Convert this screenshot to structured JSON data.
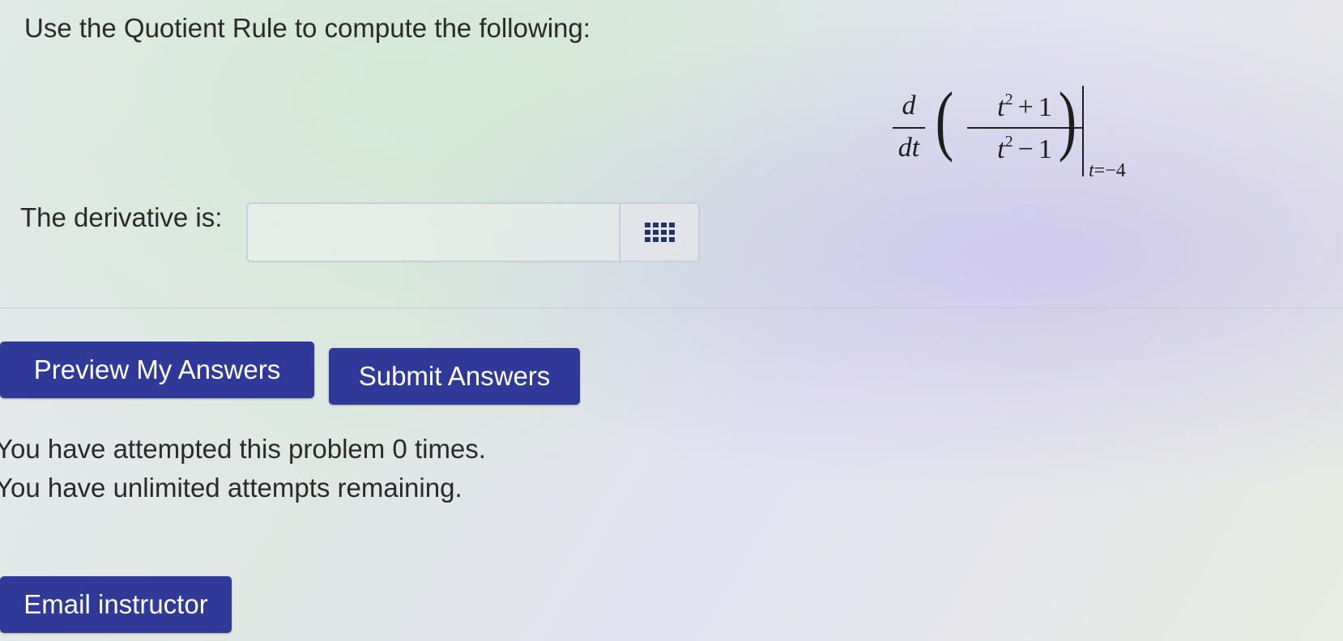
{
  "question": {
    "instruction": "Use the Quotient Rule to compute the following:"
  },
  "math": {
    "d_num": "d",
    "d_den": "dt",
    "open_paren": "(",
    "close_paren": ")",
    "num_base": "t",
    "num_exp": "2",
    "num_op": "+",
    "num_const": "1",
    "den_base": "t",
    "den_exp": "2",
    "den_op": "−",
    "den_const": "1",
    "eval_var": "t",
    "eval_eq": "=",
    "eval_val": "−4"
  },
  "answer": {
    "label": "The derivative is:",
    "value": "",
    "placeholder": ""
  },
  "buttons": {
    "preview": "Preview My Answers",
    "submit": "Submit Answers",
    "email": "Email instructor"
  },
  "status": {
    "attempts": "You have attempted this problem 0 times.",
    "remaining": "You have unlimited attempts remaining."
  },
  "icons": {
    "palette": "equation-editor-grid-icon"
  },
  "colors": {
    "button_bg": "#2e3998",
    "button_text": "#ffffff"
  }
}
